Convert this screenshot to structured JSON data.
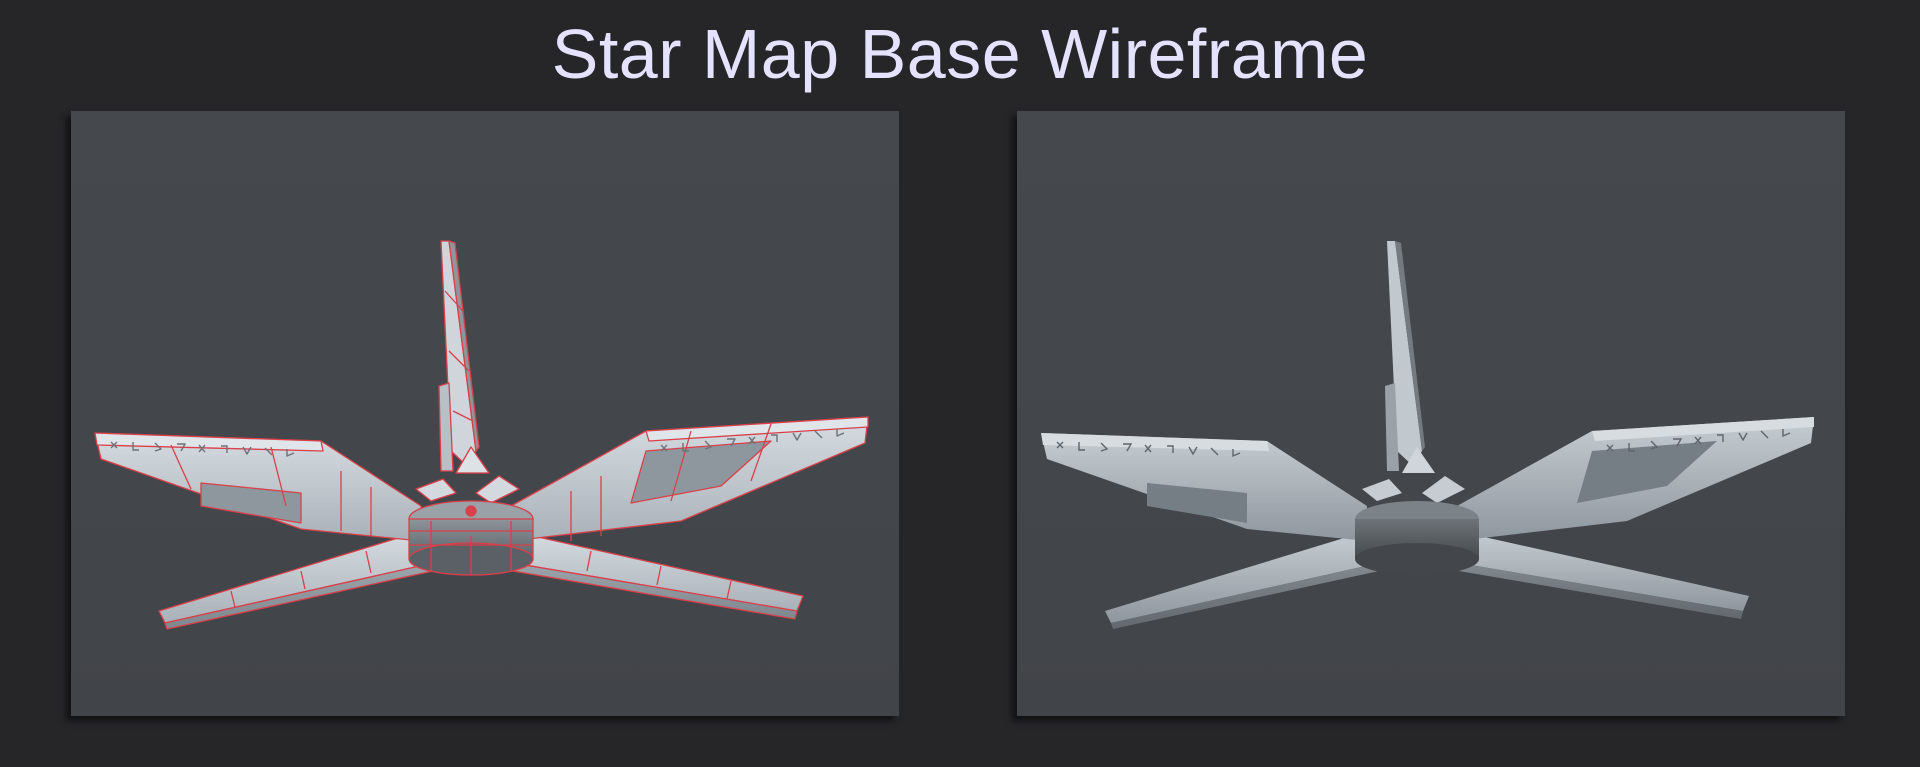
{
  "title": "Star Map Base Wireframe",
  "panels": [
    {
      "view": "wireframe",
      "mesh_color": "#c8cfd6",
      "wire_color": "#d8404a"
    },
    {
      "view": "shaded",
      "mesh_color": "#b9c0c6"
    }
  ],
  "colors": {
    "background": "#262629",
    "panel": "#44484c",
    "title": "#e4e2ff"
  }
}
